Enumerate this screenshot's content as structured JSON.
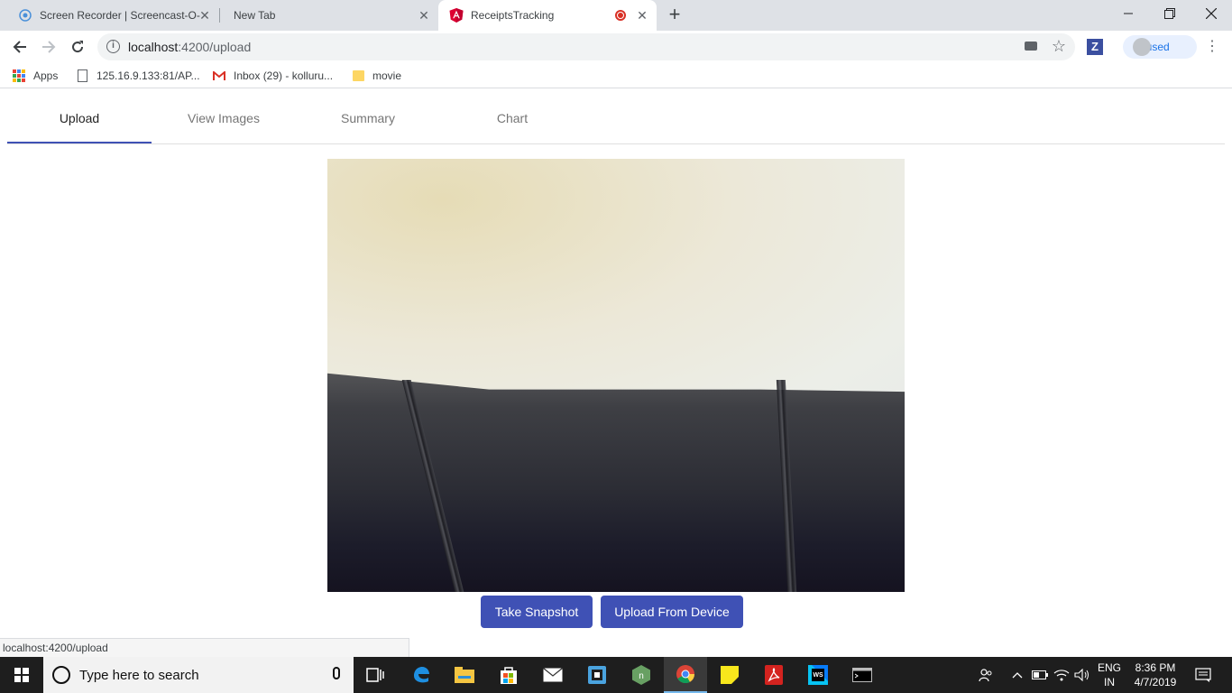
{
  "browser": {
    "tabs": [
      {
        "title": "Screen Recorder | Screencast-O-M",
        "favicon": "screencast-o-matic-icon"
      },
      {
        "title": "New Tab",
        "favicon": ""
      },
      {
        "title": "ReceiptsTracking",
        "favicon": "angular-icon",
        "recording": true
      }
    ],
    "new_tab": "+",
    "url_host": "localhost",
    "url_path": ":4200/upload",
    "profile_label": "Paused",
    "bookmarks": [
      {
        "label": "Apps"
      },
      {
        "label": "125.16.9.133:81/AP..."
      },
      {
        "label": "Inbox (29) - kolluru..."
      },
      {
        "label": "movie"
      }
    ],
    "status_url": "localhost:4200/upload"
  },
  "app": {
    "tabs": [
      {
        "label": "Upload",
        "active": true
      },
      {
        "label": "View Images",
        "active": false
      },
      {
        "label": "Summary",
        "active": false
      },
      {
        "label": "Chart",
        "active": false
      }
    ],
    "buttons": {
      "snapshot": "Take Snapshot",
      "upload": "Upload From Device"
    },
    "accent_color": "#3f51b5"
  },
  "taskbar": {
    "search_placeholder": "Type here to search",
    "lang_top": "ENG",
    "lang_bottom": "IN",
    "time": "8:36 PM",
    "date": "4/7/2019"
  }
}
